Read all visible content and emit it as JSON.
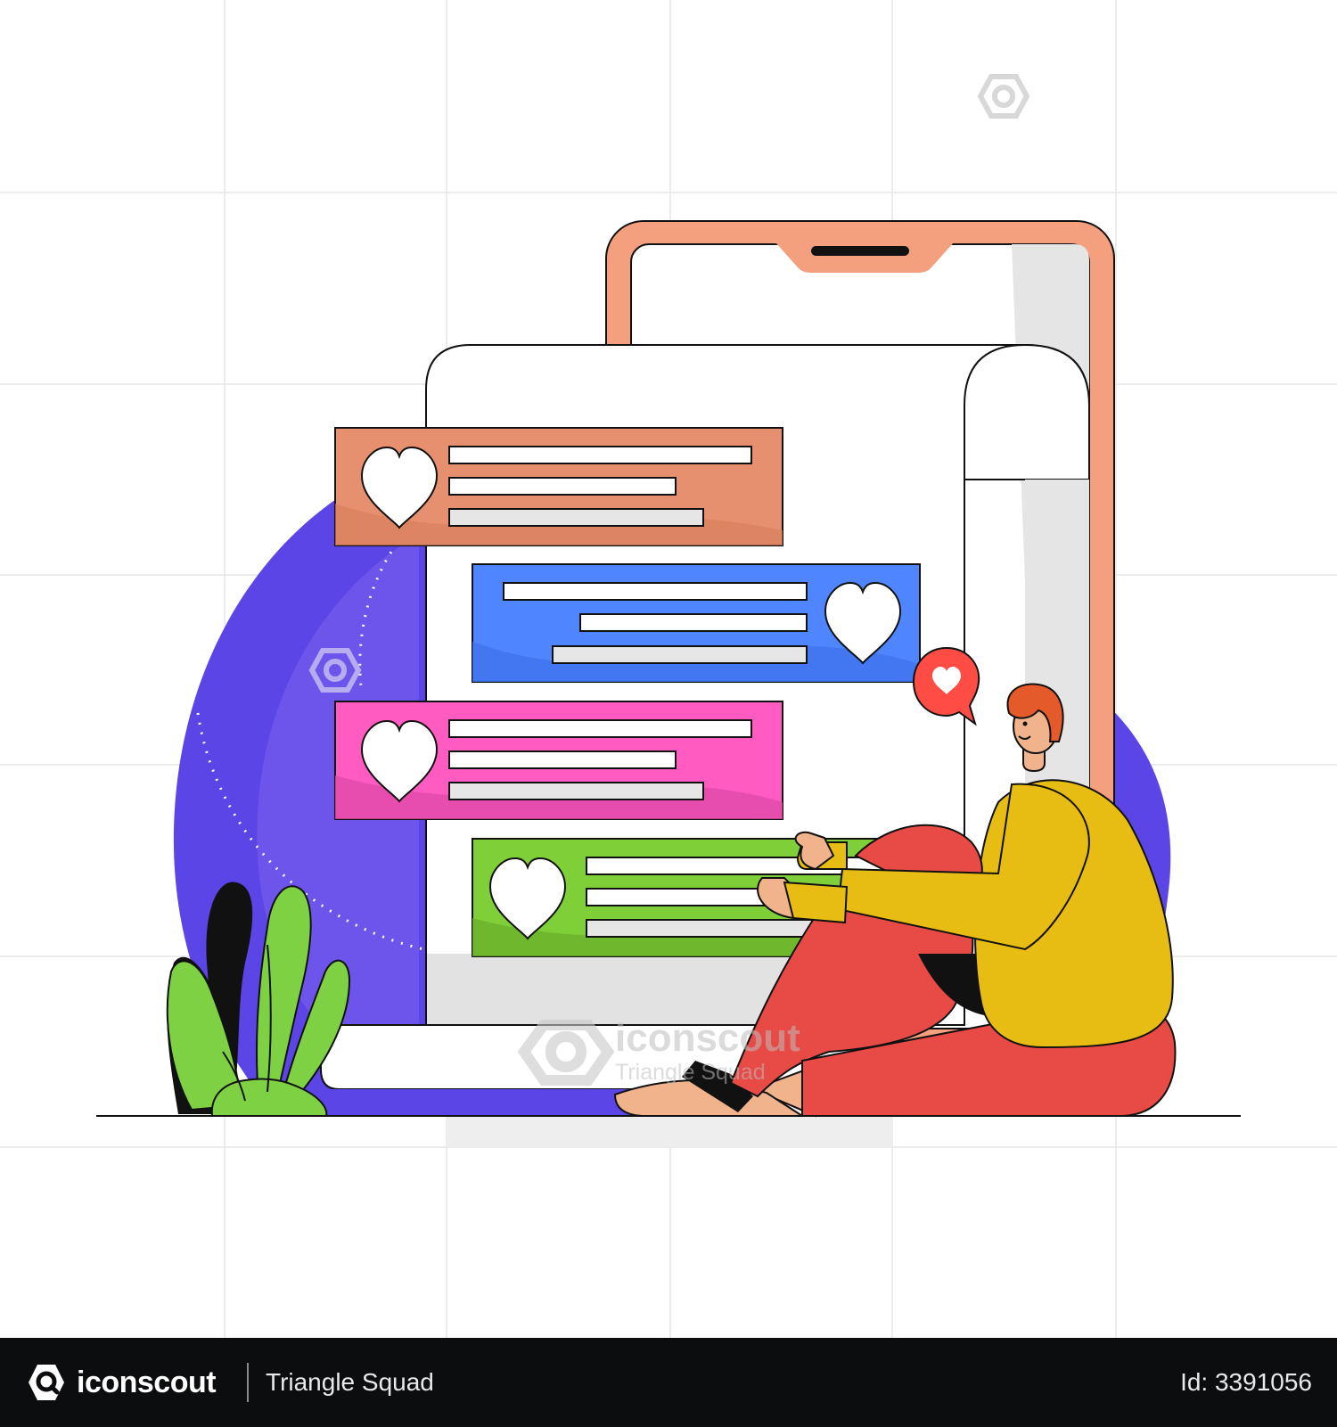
{
  "footer": {
    "brand": "iconscout",
    "author": "Triangle Squad",
    "asset_id": "Id: 3391056"
  },
  "watermark": {
    "brand": "iconscout",
    "author": "Triangle Squad"
  },
  "colors": {
    "phone_frame": "#f4a07f",
    "blob": "#5b45e6",
    "card_orange": "#e7906f",
    "card_blue": "#4f86ff",
    "card_pink": "#ff5bc0",
    "card_green": "#7fcf38",
    "sweater": "#e8bd13",
    "pants": "#e84a45",
    "plant": "#7fd144",
    "footer_bg": "#0c0d0f"
  },
  "icons": [
    "heart-icon",
    "love-notification-icon",
    "iconscout-logo-icon",
    "watermark-logo-icon"
  ]
}
